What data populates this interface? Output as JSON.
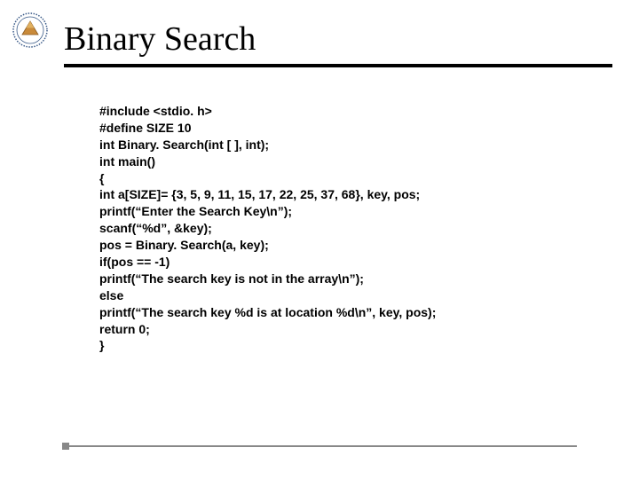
{
  "title": "Binary Search",
  "code_lines": [
    "#include <stdio. h>",
    "#define SIZE 10",
    "int Binary. Search(int [ ], int);",
    "int main()",
    "{",
    "int a[SIZE]= {3, 5, 9, 11, 15, 17, 22, 25, 37, 68}, key, pos;",
    "printf(“Enter the Search Key\\n”);",
    "scanf(“%d”, &key);",
    "pos = Binary. Search(a, key);",
    "if(pos == -1)",
    "printf(“The search key is not in the array\\n”);",
    "else",
    "printf(“The search key %d is at location %d\\n”, key, pos);",
    "return 0;",
    "}"
  ]
}
